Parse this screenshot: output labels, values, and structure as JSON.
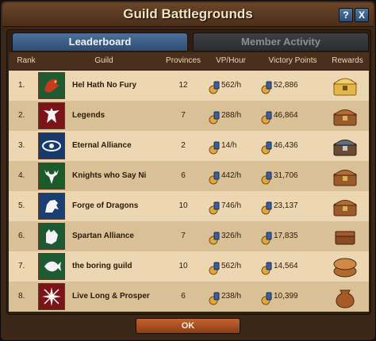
{
  "window": {
    "title": "Guild Battlegrounds",
    "help_label": "?",
    "close_label": "X"
  },
  "tabs": [
    {
      "label": "Leaderboard",
      "active": true
    },
    {
      "label": "Member Activity",
      "active": false
    }
  ],
  "columns": {
    "rank": "Rank",
    "guild": "Guild",
    "provinces": "Provinces",
    "vp_hour": "VP/Hour",
    "victory_points": "Victory Points",
    "rewards": "Rewards"
  },
  "rows": [
    {
      "rank": "1.",
      "guild": "Hel Hath No Fury",
      "provinces": "12",
      "vp_hour": "562/h",
      "victory_points": "52,886",
      "emblem": "red-dragon-icon",
      "reward": "gold-chest-icon"
    },
    {
      "rank": "2.",
      "guild": "Legends",
      "provinces": "7",
      "vp_hour": "288/h",
      "victory_points": "46,864",
      "emblem": "eagle-icon",
      "reward": "wooden-chest-icon"
    },
    {
      "rank": "3.",
      "guild": "Eternal Alliance",
      "provinces": "2",
      "vp_hour": "14/h",
      "victory_points": "46,436",
      "emblem": "eye-icon",
      "reward": "iron-chest-icon"
    },
    {
      "rank": "4.",
      "guild": "Knights who Say Ni",
      "provinces": "6",
      "vp_hour": "442/h",
      "victory_points": "31,706",
      "emblem": "stag-icon",
      "reward": "wooden-chest-icon"
    },
    {
      "rank": "5.",
      "guild": "Forge of Dragons",
      "provinces": "10",
      "vp_hour": "746/h",
      "victory_points": "23,137",
      "emblem": "lion-icon",
      "reward": "wooden-chest-icon"
    },
    {
      "rank": "6.",
      "guild": "Spartan Alliance",
      "provinces": "7",
      "vp_hour": "326/h",
      "victory_points": "17,835",
      "emblem": "wolf-icon",
      "reward": "small-chest-icon"
    },
    {
      "rank": "7.",
      "guild": "the boring guild",
      "provinces": "10",
      "vp_hour": "562/h",
      "victory_points": "14,564",
      "emblem": "fish-icon",
      "reward": "barrel-icon"
    },
    {
      "rank": "8.",
      "guild": "Live Long & Prosper",
      "provinces": "6",
      "vp_hour": "238/h",
      "victory_points": "10,399",
      "emblem": "cross-icon",
      "reward": "sack-icon"
    }
  ],
  "ok_label": "OK",
  "colors": {
    "row_light": "#ecd7b2",
    "row_dark": "#d9c097",
    "tab_active": "#3f618c",
    "ok_button": "#a84f24"
  }
}
